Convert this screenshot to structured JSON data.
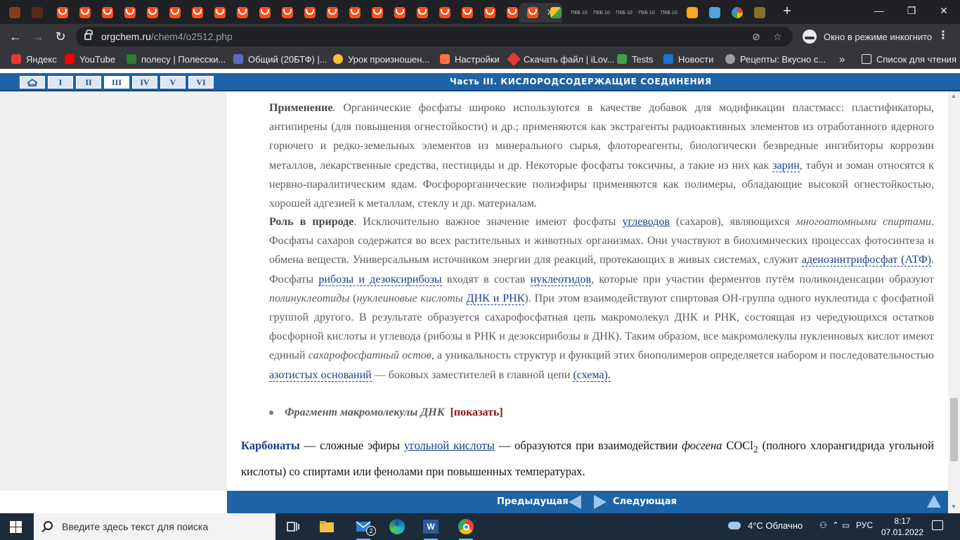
{
  "browser": {
    "tab_close": "✕",
    "new_tab": "+",
    "window": {
      "minimize": "—",
      "maximize": "❐",
      "close": "✕"
    },
    "pinned_tab_labels": [
      "ПКБ 10",
      "ПКБ 10",
      "ПКБ 10",
      "ПКБ 10",
      "ПКБ 10"
    ],
    "url_host": "orgchem.ru",
    "url_path": "/chem4/o2512.php",
    "incognito_label": "Окно в режиме инкогнито",
    "bookmarks": [
      {
        "label": "Яндекс",
        "color": "#e53935"
      },
      {
        "label": "YouTube",
        "color": "#ff0000"
      },
      {
        "label": "полесу | Полесски...",
        "color": "#2e7d32"
      },
      {
        "label": "Общий (20БТФ) |...",
        "color": "#5c6bc0"
      },
      {
        "label": "Урок произношен...",
        "color": "#fbc02d"
      },
      {
        "label": "Настройки",
        "color": "#ff7043"
      },
      {
        "label": "Скачать файл | iLov...",
        "color": "#e53935"
      },
      {
        "label": "Tests",
        "color": "#43a047"
      },
      {
        "label": "Новости",
        "color": "#1976d2"
      },
      {
        "label": "Рецепты: Вкусно с...",
        "color": "#9e9e9e"
      }
    ],
    "bookmarks_more": "»",
    "reading_list": "Список для чтения"
  },
  "site": {
    "roman_nav": [
      "I",
      "II",
      "III",
      "IV",
      "V",
      "VI"
    ],
    "active_part": "III",
    "part_title": "Часть III. КИСЛОРОДСОДЕРЖАЩИЕ СОЕДИНЕНИЯ",
    "footer": {
      "prev": "Предыдущая",
      "next": "Следующая"
    }
  },
  "content": {
    "application": {
      "head": "Применение",
      "t1": ". Органические фосфаты широко используются в качестве добавок для модификации пластмасс: пластификаторы, антипирены (для повышения огнестойкости) и др.; применяются как экстрагенты радиоактивных элементов из отработанного ядерного горючего и редко-земельных элементов из минерального сырья, флотореагенты, биологически безвредные ингибиторы коррозии металлов, лекарственные средства, пестициды и др. Некоторые фосфаты токсичны, а такие из них как ",
      "link_sarin": "зарин",
      "t2": ", табун и зоман относятся к нервно-паралитическим ядам. Фосфорорганические полиэфиры применяются как полимеры, обладающие высокой огнестойкостью, хорошей адгезией к металлам, стеклу и др. материалам."
    },
    "nature": {
      "head": "Роль в природе",
      "t1": ". Исключительно важное значение имеют фосфаты ",
      "link_carbs": "углеводов",
      "t2": " (сахаров), являющихся ",
      "i1": "многоатомными спиртами",
      "t3": ". Фосфаты сахаров содержатся во всех растительных и животных организмах. Они участвуют в биохимических процессах фотосинтеза и обмена веществ. Универсальным источником энергии для реакций, протекающих в живых системах, служит ",
      "link_atp": "аденозинтрифосфат (АТФ)",
      "t4": ". Фосфаты ",
      "link_ribose": "рибозы и дезоксирибозы",
      "t5": " входят в состав ",
      "link_nucleotides": "нуклеотидов",
      "t6": ", которые при участии ферментов путём поликонденсации образуют ",
      "i2": "полинуклеотиды",
      "t7": " (",
      "i3": "нуклеиновые кислоты",
      "t8": " ",
      "link_dna": "ДНК и РНК",
      "t9": "). При этом взаимодействуют спиртовая ОН-группа одного нуклеотида с фосфатной группой другого. В результате образуется сахарофосфатная цепь макромолекул ДНК и РНК, состоящая из чередующихся остатков фосфорной кислоты и углевода (рибозы в РНК и дезоксирибозы в ДНК). Таким образом, все макромолекулы нуклеиновых кислот имеют единый ",
      "i4": "сахарофосфатный остов",
      "t10": ", а уникальность структур и функций этих биополимеров определяется набором и последовательностью ",
      "link_bases": "азотистых оснований",
      "t11": " — боковых заместителей в главной цепи ",
      "link_scheme": "(схема)."
    },
    "bullet": {
      "label": "Фрагмент макромолекулы ДНК",
      "show": "[показать]"
    },
    "carbonates": {
      "head": "Карбонаты",
      "t1": " — сложные эфиры ",
      "link_acid": "угольной кислоты",
      "t2": " — образуются при взаимодействии ",
      "i1": "фосгена",
      "t3": " COCl",
      "sub": "2",
      "t4": " (полного хлорангидрида угольной кислоты) со спиртами или фенолами при повышенных температурах."
    }
  },
  "taskbar": {
    "search_placeholder": "Введите здесь текст для поиска",
    "mail_badge": "2",
    "weather": "4°C  Облачно",
    "lang": "РУС",
    "time": "8:17",
    "date": "07.01.2022"
  },
  "colors": {
    "site_blue": "#1d63a5",
    "link": "#1a3d8f",
    "show_red": "#8b1010",
    "tab_favicon": "#f4511e"
  }
}
